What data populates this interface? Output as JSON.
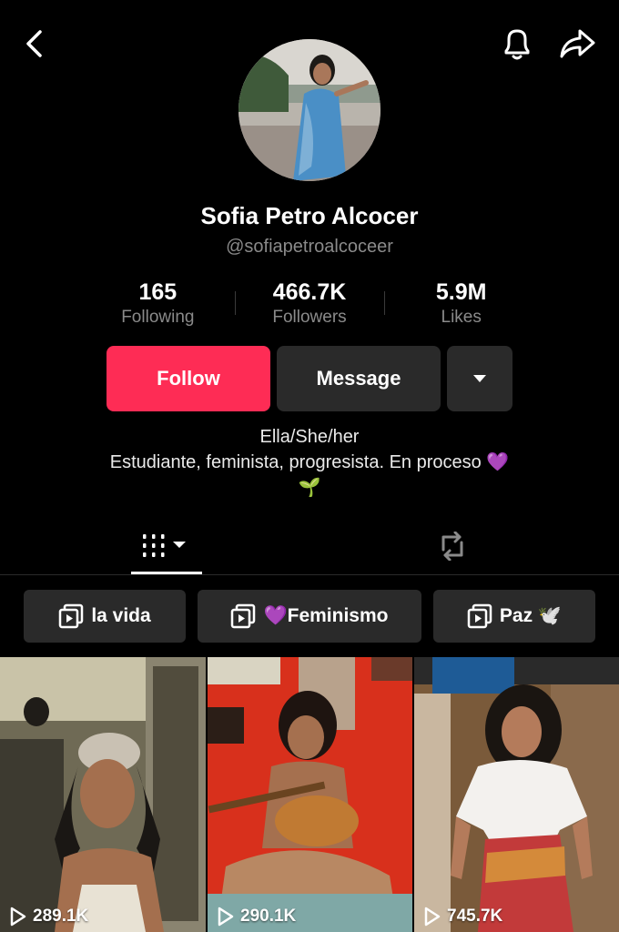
{
  "profile": {
    "name": "Sofia Petro Alcocer",
    "handle": "@sofiapetroalcoceer"
  },
  "stats": [
    {
      "value": "165",
      "label": "Following"
    },
    {
      "value": "466.7K",
      "label": "Followers"
    },
    {
      "value": "5.9M",
      "label": "Likes"
    }
  ],
  "actions": {
    "follow_label": "Follow",
    "message_label": "Message"
  },
  "bio": {
    "line1": "Ella/She/her",
    "line2": "Estudiante, feminista, progresista. En proceso 💜",
    "line3": "🌱"
  },
  "playlists": [
    {
      "label": "la vida"
    },
    {
      "label": "💜Feminismo"
    },
    {
      "label": "Paz 🕊️"
    }
  ],
  "videos": [
    {
      "views": "289.1K"
    },
    {
      "views": "290.1K"
    },
    {
      "views": "745.7K"
    }
  ],
  "colors": {
    "accent": "#fe2c55",
    "button_dark": "#2a2a2a",
    "muted_text": "#8a8a8a"
  }
}
